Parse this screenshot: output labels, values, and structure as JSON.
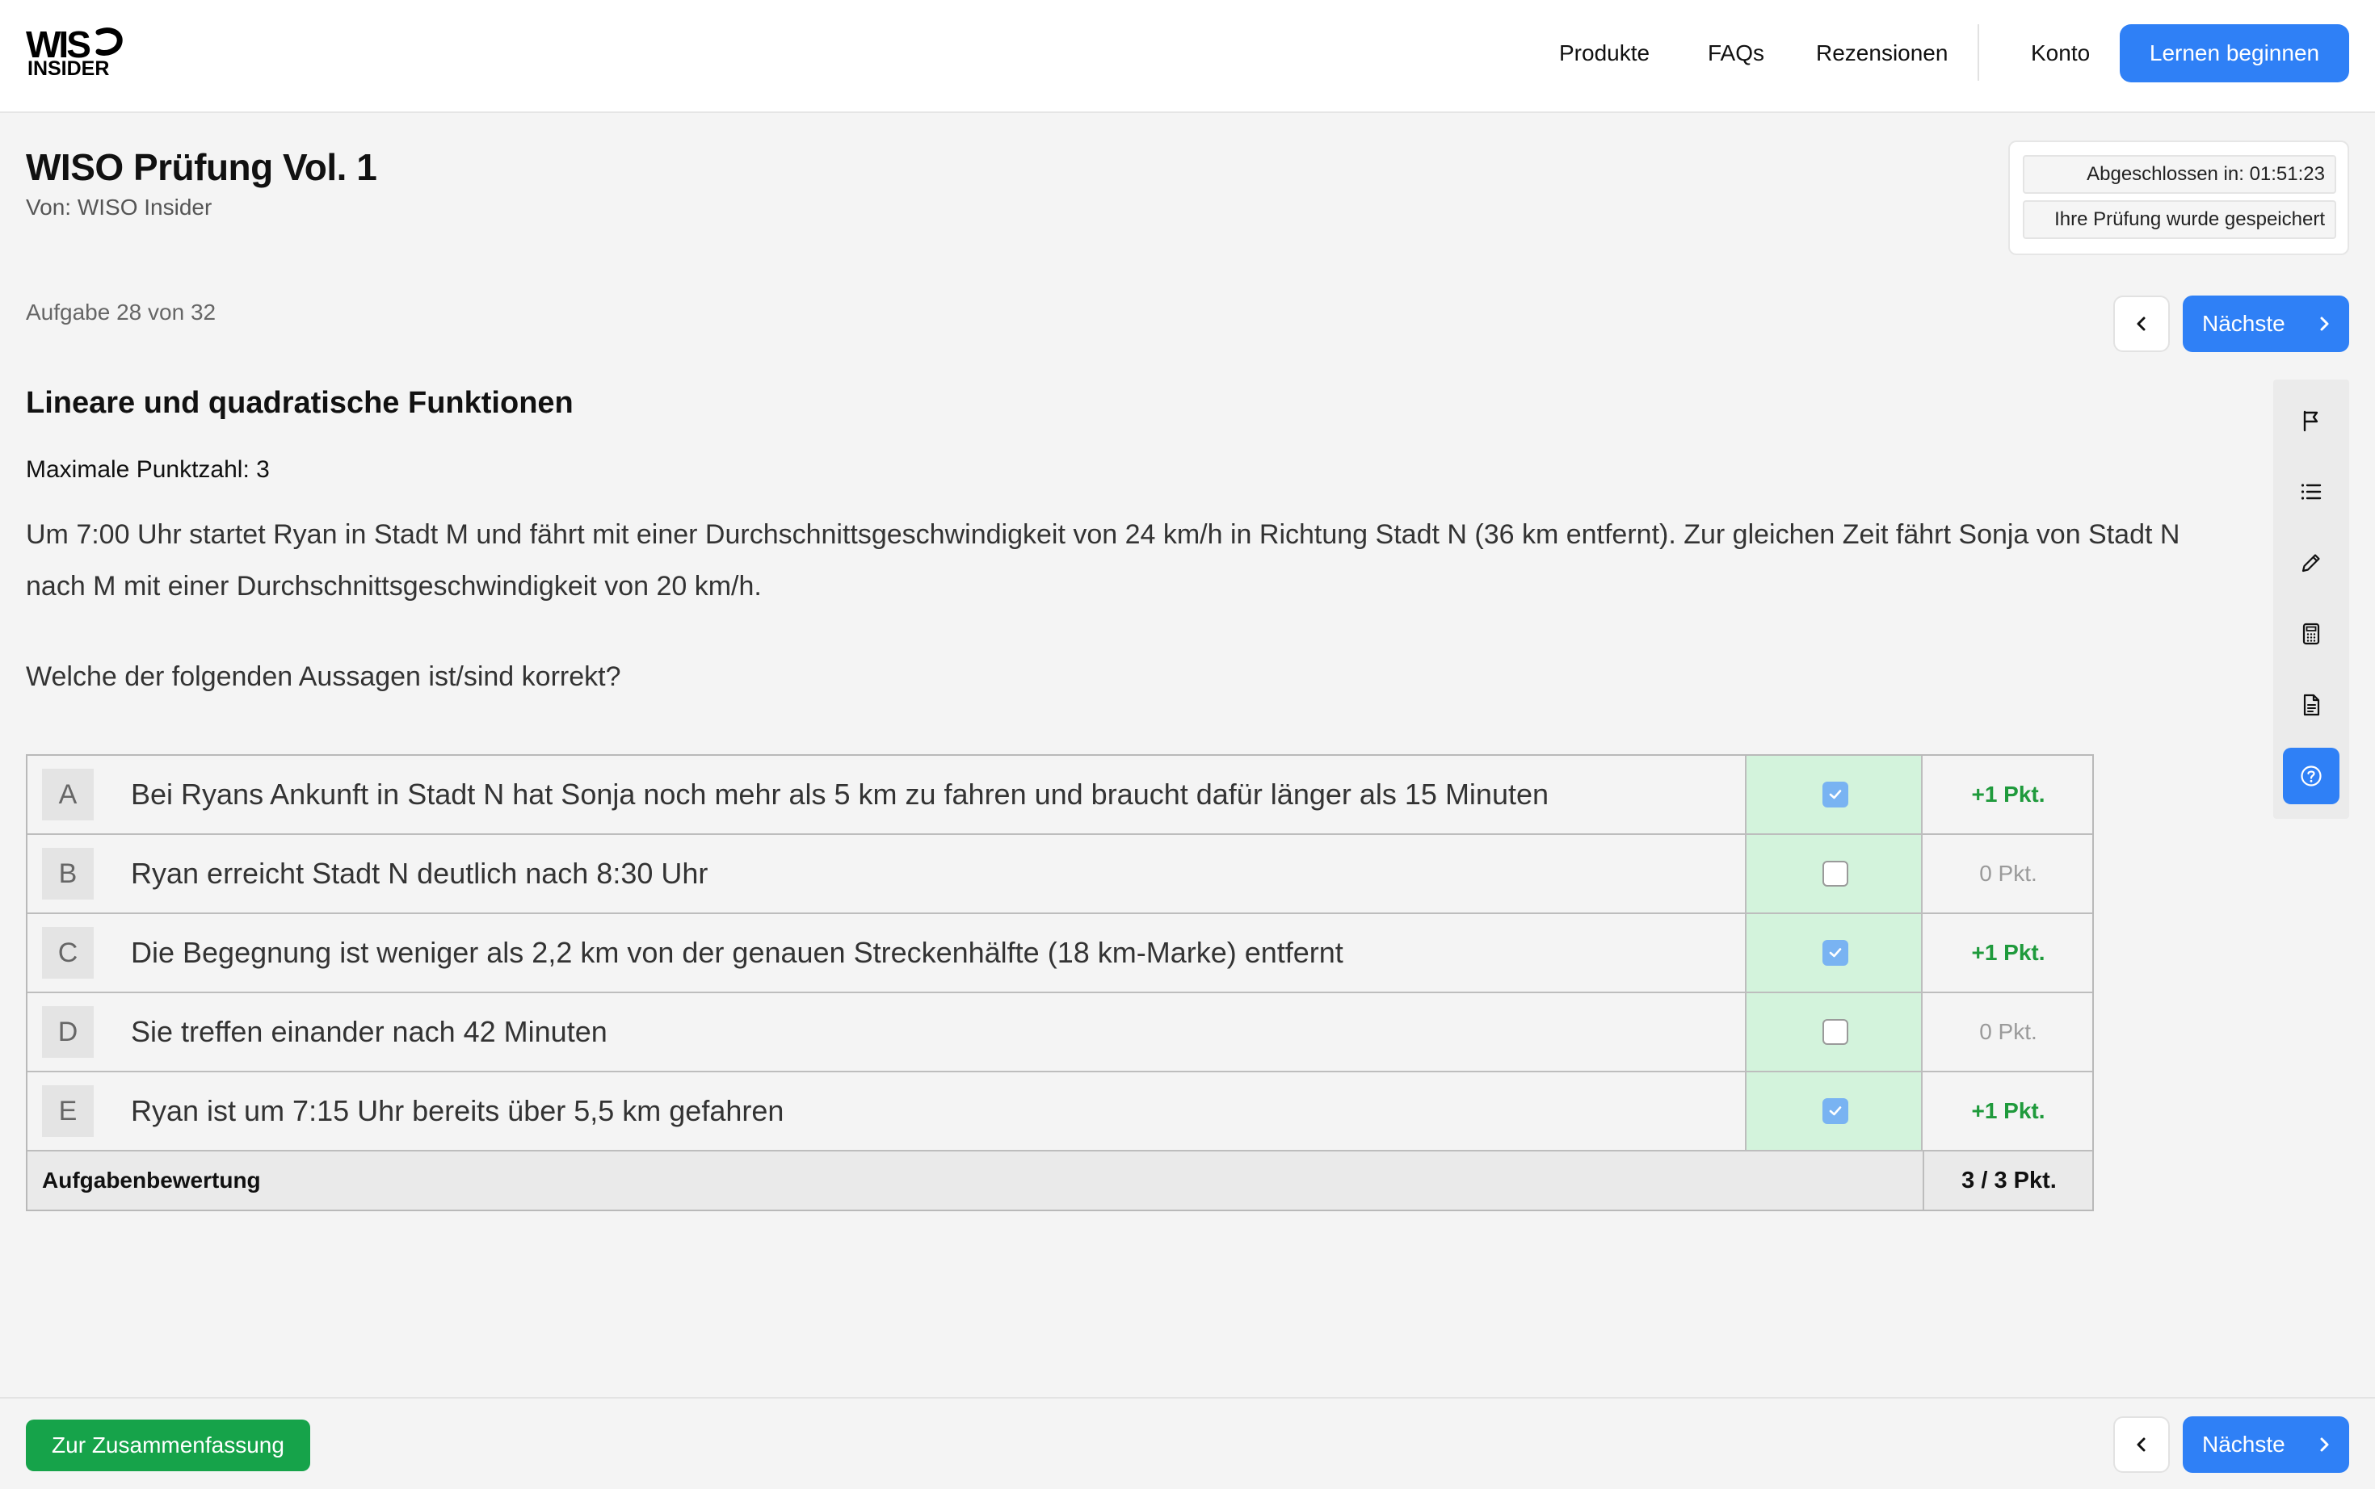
{
  "brand": {
    "line1": "WIS",
    "line2": "INSIDER"
  },
  "nav": {
    "items": [
      "Produkte",
      "FAQs",
      "Rezensionen"
    ],
    "account": "Konto",
    "cta": "Lernen beginnen"
  },
  "exam": {
    "title": "WISO Prüfung Vol. 1",
    "author": "Von: WISO Insider",
    "status_completed": "Abgeschlossen in: 01:51:23",
    "status_saved": "Ihre Prüfung wurde gespeichert",
    "task_counter": "Aufgabe 28 von 32"
  },
  "navigation": {
    "next_label": "Nächste"
  },
  "question": {
    "topic": "Lineare und quadratische Funktionen",
    "max_points": "Maximale Punktzahl: 3",
    "text": "Um 7:00 Uhr startet Ryan in Stadt M und fährt mit einer Durchschnittsgeschwindigkeit von 24 km/h in Richtung Stadt N (36 km entfernt). Zur gleichen Zeit fährt Sonja von Stadt N nach M mit einer Durchschnittsgeschwindigkeit von 20 km/h.",
    "prompt": "Welche der folgenden Aussagen ist/sind korrekt?"
  },
  "answers": [
    {
      "letter": "A",
      "text": "Bei Ryans Ankunft in Stadt N hat Sonja noch mehr als 5 km zu fahren und braucht dafür länger als 15 Minuten",
      "checked": true,
      "points": "+1 Pkt."
    },
    {
      "letter": "B",
      "text": "Ryan erreicht Stadt N deutlich nach 8:30 Uhr",
      "checked": false,
      "points": "0 Pkt."
    },
    {
      "letter": "C",
      "text": "Die Begegnung ist weniger als 2,2 km von der genauen Streckenhälfte (18 km-Marke) entfernt",
      "checked": true,
      "points": "+1 Pkt."
    },
    {
      "letter": "D",
      "text": "Sie treffen einander nach 42 Minuten",
      "checked": false,
      "points": "0 Pkt."
    },
    {
      "letter": "E",
      "text": "Ryan ist um 7:15 Uhr bereits über 5,5 km gefahren",
      "checked": true,
      "points": "+1 Pkt."
    }
  ],
  "evaluation": {
    "label": "Aufgabenbewertung",
    "value": "3 / 3 Pkt."
  },
  "tools": [
    "flag-icon",
    "list-icon",
    "pencil-icon",
    "calculator-icon",
    "document-icon",
    "help-icon"
  ],
  "footer": {
    "summary_label": "Zur Zusammenfassung"
  },
  "colors": {
    "accent": "#2f80f6",
    "success": "#16a34a",
    "correct_cell": "#d3f3dc",
    "points_positive": "#1f9a3c"
  }
}
